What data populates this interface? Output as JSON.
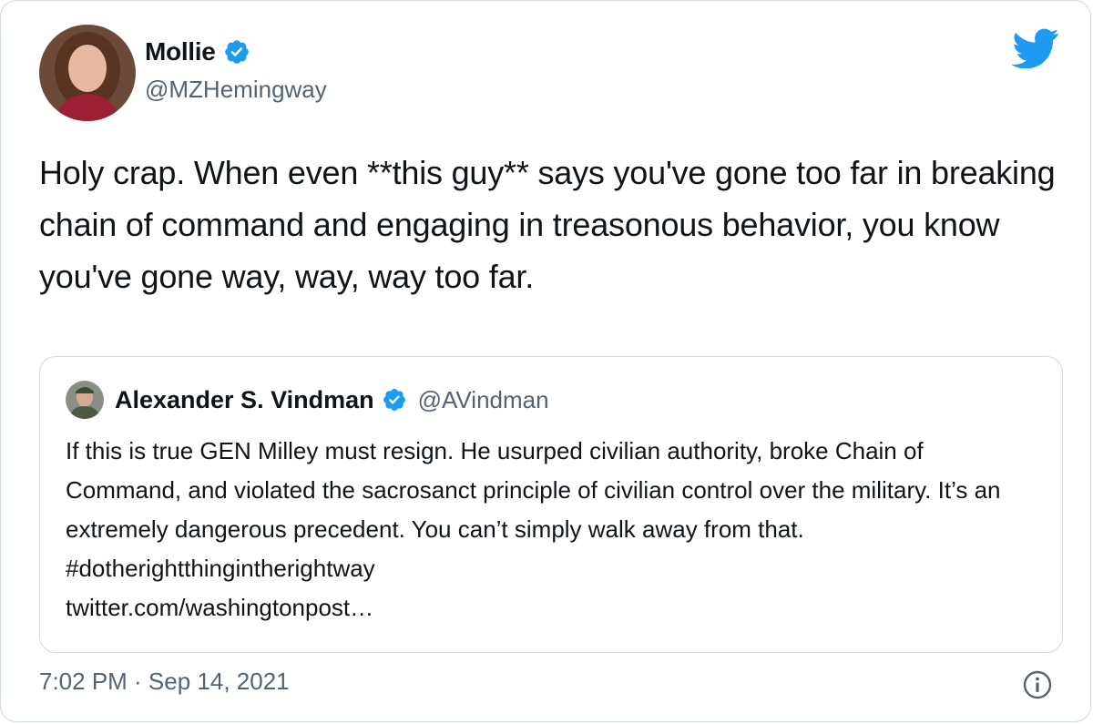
{
  "author": {
    "name": "Mollie",
    "handle": "@MZHemingway",
    "verified": true
  },
  "tweet": {
    "text": "Holy crap. When even **this guy** says you've gone too far in breaking chain of command and engaging in treasonous behavior, you know you've gone way, way, way too far.",
    "timestamp": "7:02 PM · Sep 14, 2021"
  },
  "quoted_tweet": {
    "name": "Alexander S. Vindman",
    "handle": "@AVindman",
    "verified": true,
    "text": "If this is true GEN Milley must resign. He usurped civilian authority, broke Chain of Command, and violated the sacrosanct principle of civilian control over the military. It’s an extremely dangerous precedent. You can’t simply walk away from that. #dotherightthingintherightway",
    "link": "twitter.com/washingtonpost…"
  },
  "icons": {
    "brand": "twitter-bird-icon",
    "verified": "verified-badge-icon",
    "info": "info-icon"
  },
  "colors": {
    "brand_blue": "#1d9bf0",
    "text_primary": "#0f1419",
    "text_secondary": "#536471",
    "border": "#cfd9de"
  }
}
